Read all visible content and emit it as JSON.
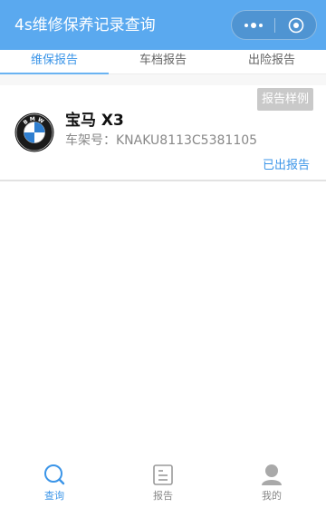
{
  "nav": {
    "title": "4s维修保养记录查询",
    "more_icon": "more-dots-icon",
    "close_icon": "close-circle-icon"
  },
  "tabs": [
    {
      "label": "维保报告",
      "active": true
    },
    {
      "label": "车档报告",
      "active": false
    },
    {
      "label": "出险报告",
      "active": false
    }
  ],
  "report": {
    "sample_label": "报告样例",
    "brand_logo": "bmw-logo",
    "logo_text": "BMW",
    "car_name": "宝马 X3",
    "vin_text": "车架号：KNAKU8113C5381105",
    "status": "已出报告"
  },
  "bottom_tabs": [
    {
      "label": "查询",
      "icon": "search-icon",
      "active": true
    },
    {
      "label": "报告",
      "icon": "report-icon",
      "active": false
    },
    {
      "label": "我的",
      "icon": "user-icon",
      "active": false
    }
  ],
  "colors": {
    "nav_bg": "#5aa9ef",
    "accent": "#3b95e8",
    "sample_button_bg": "#c9c9c9"
  }
}
